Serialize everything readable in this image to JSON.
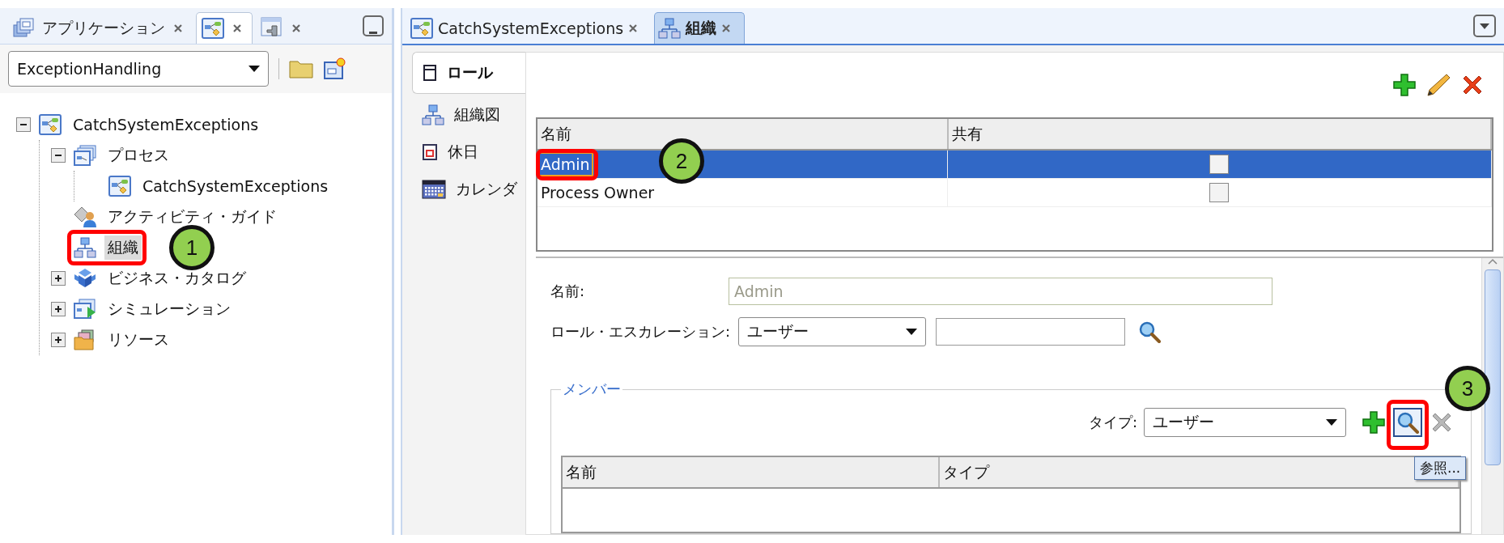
{
  "left_panel": {
    "tabs": [
      {
        "kind": "applications",
        "label": "アプリケーション",
        "selected": false
      },
      {
        "kind": "process",
        "selected": true
      },
      {
        "kind": "plug",
        "selected": false
      }
    ],
    "project_select": {
      "value": "ExceptionHandling"
    },
    "tree": [
      {
        "kind": "process",
        "label": "CatchSystemExceptions",
        "expanded": true,
        "selected": false,
        "children": [
          {
            "kind": "processes",
            "label": "プロセス",
            "expanded": true,
            "selected": false,
            "children": [
              {
                "kind": "process",
                "label": "CatchSystemExceptions",
                "selected": false
              }
            ]
          },
          {
            "kind": "guide",
            "label": "アクティビティ・ガイド",
            "selected": false
          },
          {
            "kind": "organization",
            "label": "組織",
            "selected": true
          },
          {
            "kind": "catalog",
            "label": "ビジネス・カタログ",
            "expanded": false,
            "selected": false
          },
          {
            "kind": "simulation",
            "label": "シミュレーション",
            "expanded": false,
            "selected": false
          },
          {
            "kind": "resources",
            "label": "リソース",
            "expanded": false,
            "selected": false
          }
        ]
      }
    ]
  },
  "editor_tabs": [
    {
      "kind": "process",
      "label": "CatchSystemExceptions",
      "selected": false
    },
    {
      "kind": "organization",
      "label": "組織",
      "selected": true
    }
  ],
  "side_tabs": [
    {
      "kind": "role",
      "label": "ロール",
      "selected": true
    },
    {
      "kind": "organization",
      "label": "組織図",
      "selected": false
    },
    {
      "kind": "holiday",
      "label": "休日",
      "selected": false
    },
    {
      "kind": "calendar",
      "label": "カレンダ",
      "selected": false
    }
  ],
  "roles_table": {
    "columns": [
      "名前",
      "共有"
    ],
    "rows": [
      {
        "name": "Admin",
        "shared": false,
        "selected": true
      },
      {
        "name": "Process Owner",
        "shared": false,
        "selected": false
      }
    ]
  },
  "detail": {
    "name_label": "名前:",
    "name_value": "Admin",
    "name_disabled": true,
    "escalation_label": "ロール・エスカレーション:",
    "escalation_value": "ユーザー"
  },
  "members": {
    "legend": "メンバー",
    "type_label": "タイプ:",
    "type_value": "ユーザー",
    "columns": [
      "名前",
      "タイプ"
    ],
    "tooltip": "参照..."
  },
  "callouts": [
    {
      "label": "1"
    },
    {
      "label": "2"
    },
    {
      "label": "3"
    }
  ]
}
